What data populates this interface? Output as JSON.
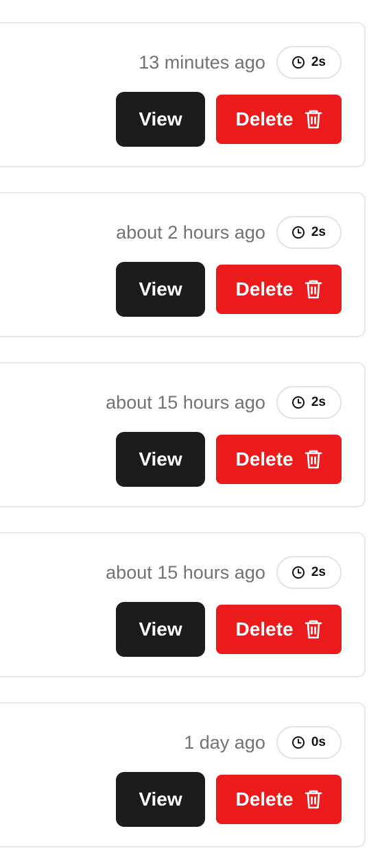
{
  "colors": {
    "view_bg": "#1c1c1e",
    "delete_bg": "#ec1b1b",
    "timestamp_text": "#71717a",
    "card_border": "#e5e7eb"
  },
  "icons": {
    "duration": "clock-icon",
    "delete": "trash-icon"
  },
  "runs": [
    {
      "timestamp": "13 minutes ago",
      "duration": "2s",
      "view_label": "View",
      "delete_label": "Delete"
    },
    {
      "timestamp": "about 2 hours ago",
      "duration": "2s",
      "view_label": "View",
      "delete_label": "Delete"
    },
    {
      "timestamp": "about 15 hours ago",
      "duration": "2s",
      "view_label": "View",
      "delete_label": "Delete"
    },
    {
      "timestamp": "about 15 hours ago",
      "duration": "2s",
      "view_label": "View",
      "delete_label": "Delete"
    },
    {
      "timestamp": "1 day ago",
      "duration": "0s",
      "view_label": "View",
      "delete_label": "Delete"
    }
  ]
}
